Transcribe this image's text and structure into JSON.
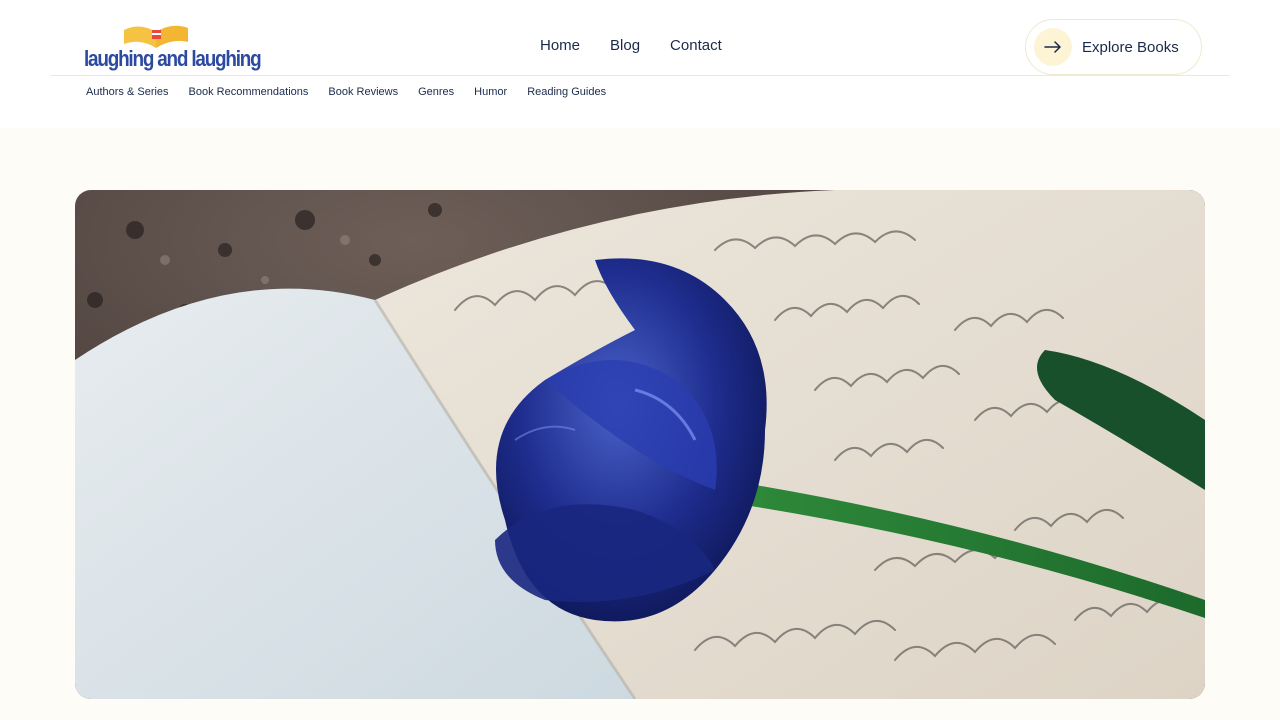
{
  "brand": {
    "logo_text": "laughing and laughing"
  },
  "main_nav": [
    {
      "label": "Home"
    },
    {
      "label": "Blog"
    },
    {
      "label": "Contact"
    }
  ],
  "cta": {
    "label": "Explore Books",
    "icon": "arrow-right-icon"
  },
  "sub_nav": [
    {
      "label": "Authors & Series"
    },
    {
      "label": "Book Recommendations"
    },
    {
      "label": "Book Reviews"
    },
    {
      "label": "Genres"
    },
    {
      "label": "Humor"
    },
    {
      "label": "Reading Guides"
    }
  ],
  "hero": {
    "image": "blue-tulip-on-handwritten-notebook"
  },
  "colors": {
    "brand_blue": "#2b4aa0",
    "accent_yellow": "#f5c242",
    "text": "#1b2a4a",
    "page_bg": "#fdfcf7"
  }
}
